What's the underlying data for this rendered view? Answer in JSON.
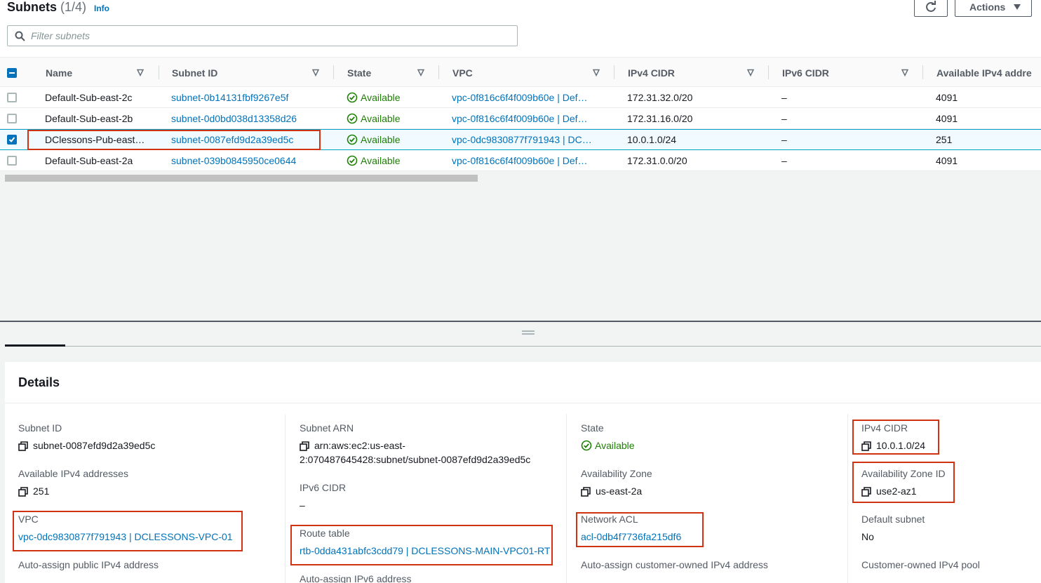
{
  "header": {
    "title": "Subnets",
    "count": "(1/4)",
    "info": "Info",
    "actions_label": "Actions",
    "filter_placeholder": "Filter subnets"
  },
  "table": {
    "columns": [
      "Name",
      "Subnet ID",
      "State",
      "VPC",
      "IPv4 CIDR",
      "IPv6 CIDR",
      "Available IPv4 addre"
    ],
    "rows": [
      {
        "name": "Default-Sub-east-2c",
        "subnet_id": "subnet-0b14131fbf9267e5f",
        "state": "Available",
        "vpc": "vpc-0f816c6f4f009b60e | Def…",
        "ipv4": "172.31.32.0/20",
        "ipv6": "–",
        "avail": "4091",
        "selected": false
      },
      {
        "name": "Default-Sub-east-2b",
        "subnet_id": "subnet-0d0bd038d13358d26",
        "state": "Available",
        "vpc": "vpc-0f816c6f4f009b60e | Def…",
        "ipv4": "172.31.16.0/20",
        "ipv6": "–",
        "avail": "4091",
        "selected": false
      },
      {
        "name": "DClessons-Pub-east…",
        "subnet_id": "subnet-0087efd9d2a39ed5c",
        "state": "Available",
        "vpc": "vpc-0dc9830877f791943 | DC…",
        "ipv4": "10.0.1.0/24",
        "ipv6": "–",
        "avail": "251",
        "selected": true
      },
      {
        "name": "Default-Sub-east-2a",
        "subnet_id": "subnet-039b0845950ce0644",
        "state": "Available",
        "vpc": "vpc-0f816c6f4f009b60e | Def…",
        "ipv4": "172.31.0.0/20",
        "ipv6": "–",
        "avail": "4091",
        "selected": false
      }
    ]
  },
  "details": {
    "title": "Details",
    "subnet_id_label": "Subnet ID",
    "subnet_id": "subnet-0087efd9d2a39ed5c",
    "avail_label": "Available IPv4 addresses",
    "avail": "251",
    "vpc_label": "VPC",
    "vpc": "vpc-0dc9830877f791943 | DCLESSONS-VPC-01",
    "auto_public_label": "Auto-assign public IPv4 address",
    "arn_label": "Subnet ARN",
    "arn_line1": "arn:aws:ec2:us-east-",
    "arn_line2": "2:070487645428:subnet/subnet-0087efd9d2a39ed5c",
    "ipv6_label": "IPv6 CIDR",
    "ipv6": "–",
    "route_label": "Route table",
    "route": "rtb-0dda431abfc3cdd79 | DCLESSONS-MAIN-VPC01-RT",
    "auto_ipv6_label": "Auto-assign IPv6 address",
    "state_label": "State",
    "state": "Available",
    "az_label": "Availability Zone",
    "az": "us-east-2a",
    "nacl_label": "Network ACL",
    "nacl": "acl-0db4f7736fa215df6",
    "auto_customer_label": "Auto-assign customer-owned IPv4 address",
    "ipv4_label": "IPv4 CIDR",
    "ipv4": "10.0.1.0/24",
    "azid_label": "Availability Zone ID",
    "azid": "use2-az1",
    "default_label": "Default subnet",
    "default": "No",
    "pool_label": "Customer-owned IPv4 pool"
  },
  "colors": {
    "link": "#0073bb",
    "available": "#1d8102",
    "highlight": "#d13212",
    "selected_row": "#f1faff"
  }
}
